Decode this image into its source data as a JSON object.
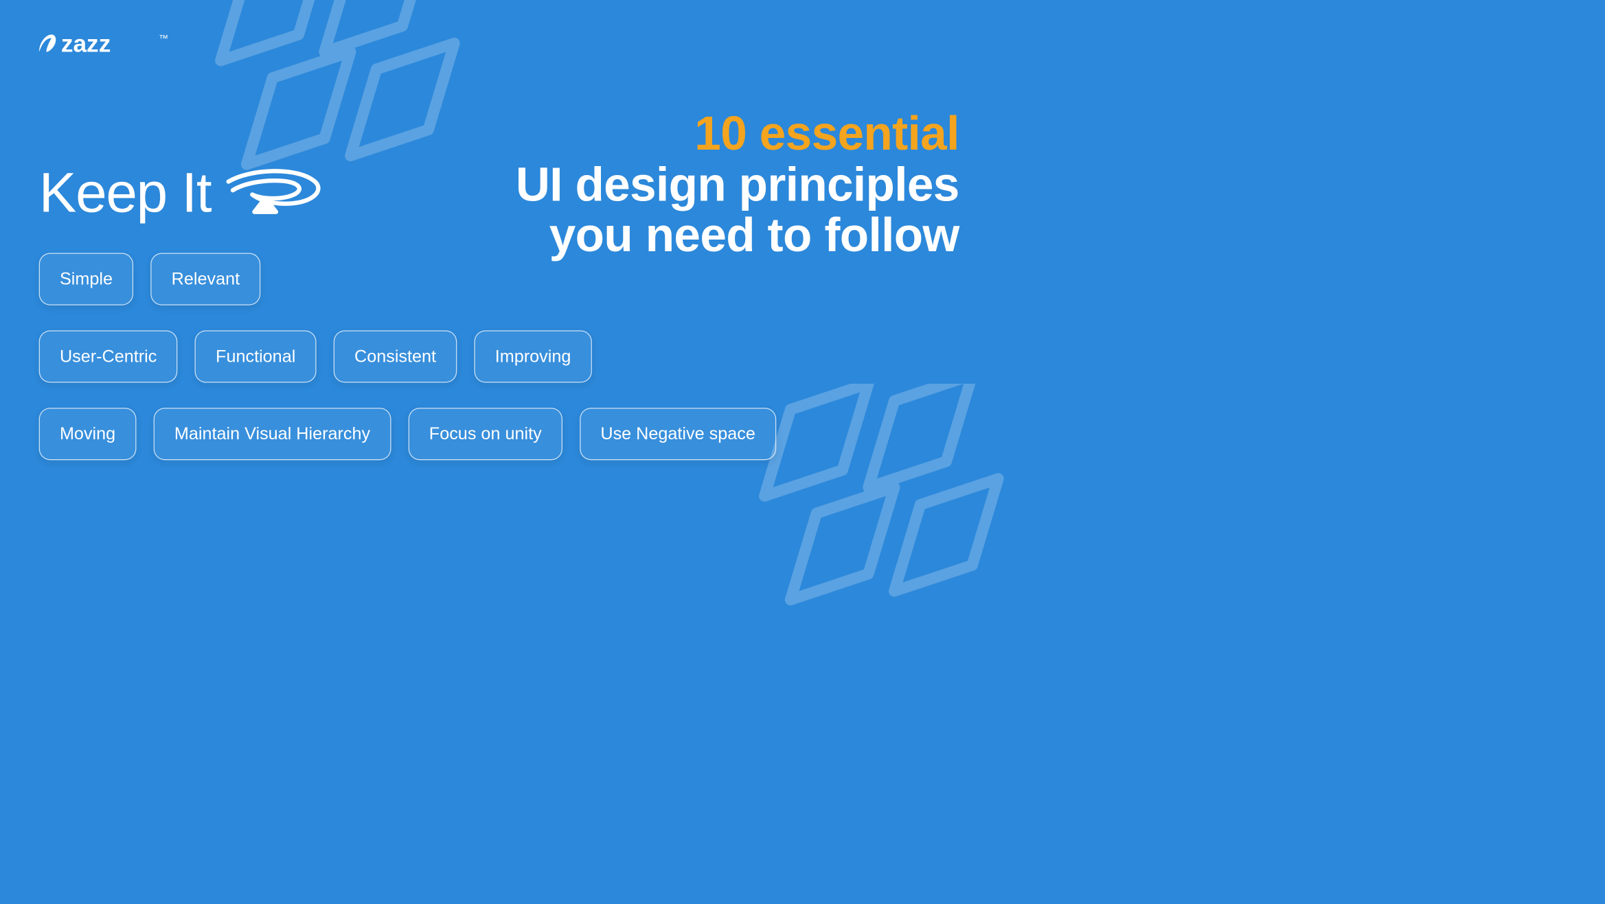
{
  "brand": {
    "name": "zazz",
    "tm": "™"
  },
  "headline": {
    "line1": "10 essential",
    "line2": "UI design principles",
    "line3": "you need to follow"
  },
  "keep_it": {
    "label": "Keep It"
  },
  "principles": {
    "row1": [
      "Simple",
      "Relevant"
    ],
    "row2": [
      "User-Centric",
      "Functional",
      "Consistent",
      "Improving"
    ],
    "row3": [
      "Moving",
      "Maintain Visual Hierarchy",
      "Focus on unity",
      "Use Negative space"
    ]
  },
  "colors": {
    "bg": "#2c88da",
    "accent": "#f4a41e",
    "stroke": "#ffffff"
  }
}
